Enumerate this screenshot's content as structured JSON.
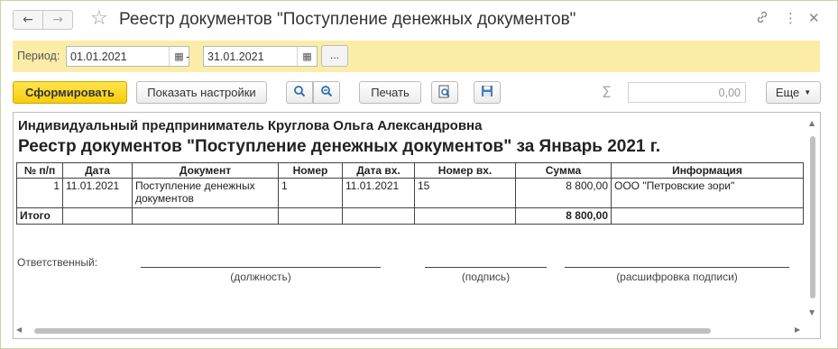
{
  "window": {
    "title": "Реестр документов \"Поступление денежных документов\"",
    "nav_back_icon": "arrow-left-icon",
    "nav_forward_icon": "arrow-right-icon",
    "favorite_icon": "star-icon",
    "link_icon": "link-icon",
    "menu_icon": "kebab-menu-icon",
    "close_icon": "close-icon"
  },
  "period": {
    "label": "Период:",
    "from": "01.01.2021",
    "to": "31.01.2021",
    "separator": "-",
    "choose_label": "..."
  },
  "toolbar": {
    "generate_label": "Сформировать",
    "settings_label": "Показать настройки",
    "print_label": "Печать",
    "sum_value": "0,00",
    "more_label": "Еще"
  },
  "report": {
    "org": "Индивидуальный предприниматель Круглова Ольга Александровна",
    "title": "Реестр документов \"Поступление денежных документов\" за Январь 2021 г.",
    "columns": [
      "№ п/п",
      "Дата",
      "Документ",
      "Номер",
      "Дата вх.",
      "Номер вх.",
      "Сумма",
      "Информация"
    ],
    "rows": [
      [
        "1",
        "11.01.2021",
        "Поступление денежных документов",
        "1",
        "11.01.2021",
        "15",
        "8 800,00",
        "ООО \"Петровские зори\""
      ]
    ],
    "total_label": "Итого",
    "total_sum": "8 800,00",
    "responsible_label": "Ответственный:",
    "position_caption": "(должность)",
    "signature_caption": "(подпись)",
    "decoding_caption": "(расшифровка подписи)"
  }
}
